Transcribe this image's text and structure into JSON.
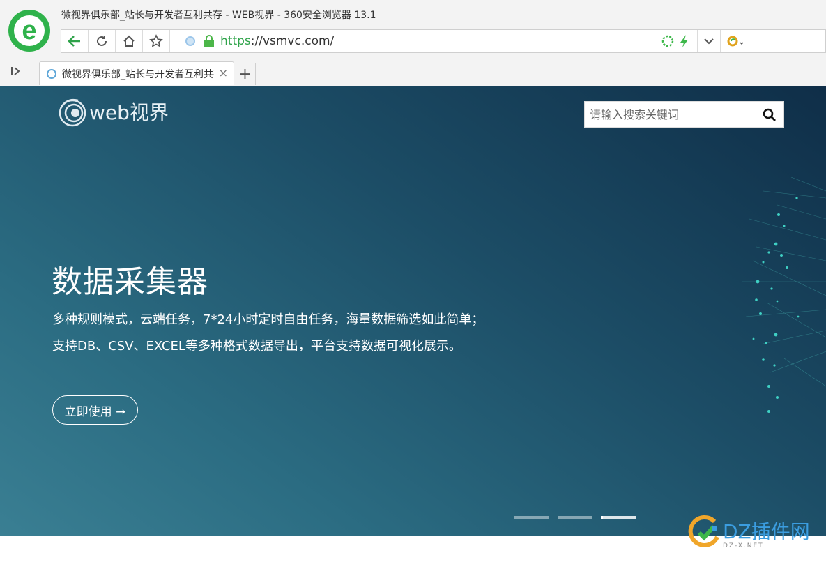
{
  "browser": {
    "window_title": "微视界俱乐部_站长与开发者互利共存 - WEB视界 - 360安全浏览器 13.1",
    "logo_letter": "e",
    "url_protocol": "https",
    "url_rest": "://vsmvc.com/",
    "tab_title": "微视界俱乐部_站长与开发者互利共存 - WEB视界",
    "new_tab_label": "+",
    "close_label": "×",
    "sidebar_toggle": "I>",
    "brand_color": "#2fb24b"
  },
  "site": {
    "logo_text": "web视界",
    "search_placeholder": "请输入搜索关键词"
  },
  "hero": {
    "title": "数据采集器",
    "desc_line1": "多种规则模式，云端任务，7*24小时定时自由任务，海量数据筛选如此简单；",
    "desc_line2": "支持DB、CSV、EXCEL等多种格式数据导出，平台支持数据可视化展示。",
    "cta_label": "立即使用 ➞",
    "slides_count": 3,
    "active_slide": 3
  },
  "watermark": {
    "text": "DZ插件网",
    "sub": "DZ-X.NET"
  }
}
